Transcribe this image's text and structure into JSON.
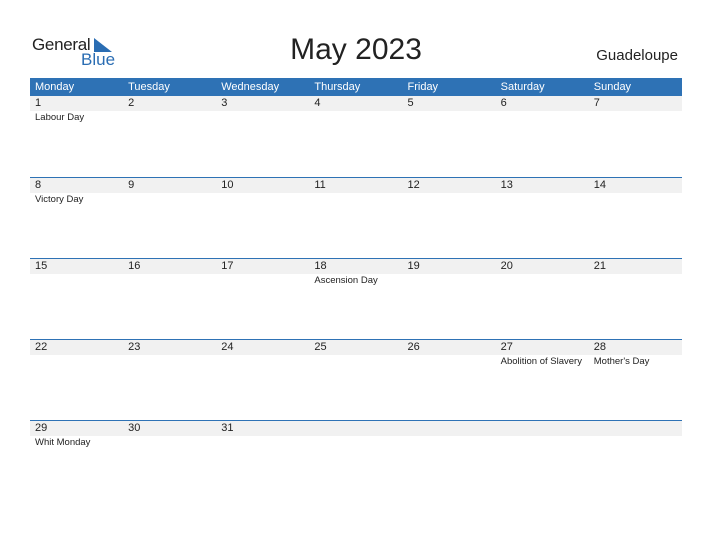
{
  "logo": {
    "word1": "General",
    "word2": "Blue"
  },
  "title": "May 2023",
  "country": "Guadeloupe",
  "colors": {
    "accent": "#2e72b5",
    "band": "#f1f1f1"
  },
  "weekdays": [
    "Monday",
    "Tuesday",
    "Wednesday",
    "Thursday",
    "Friday",
    "Saturday",
    "Sunday"
  ],
  "weeks": [
    [
      {
        "day": "1",
        "holiday": "Labour Day"
      },
      {
        "day": "2",
        "holiday": ""
      },
      {
        "day": "3",
        "holiday": ""
      },
      {
        "day": "4",
        "holiday": ""
      },
      {
        "day": "5",
        "holiday": ""
      },
      {
        "day": "6",
        "holiday": ""
      },
      {
        "day": "7",
        "holiday": ""
      }
    ],
    [
      {
        "day": "8",
        "holiday": "Victory Day"
      },
      {
        "day": "9",
        "holiday": ""
      },
      {
        "day": "10",
        "holiday": ""
      },
      {
        "day": "11",
        "holiday": ""
      },
      {
        "day": "12",
        "holiday": ""
      },
      {
        "day": "13",
        "holiday": ""
      },
      {
        "day": "14",
        "holiday": ""
      }
    ],
    [
      {
        "day": "15",
        "holiday": ""
      },
      {
        "day": "16",
        "holiday": ""
      },
      {
        "day": "17",
        "holiday": ""
      },
      {
        "day": "18",
        "holiday": "Ascension Day"
      },
      {
        "day": "19",
        "holiday": ""
      },
      {
        "day": "20",
        "holiday": ""
      },
      {
        "day": "21",
        "holiday": ""
      }
    ],
    [
      {
        "day": "22",
        "holiday": ""
      },
      {
        "day": "23",
        "holiday": ""
      },
      {
        "day": "24",
        "holiday": ""
      },
      {
        "day": "25",
        "holiday": ""
      },
      {
        "day": "26",
        "holiday": ""
      },
      {
        "day": "27",
        "holiday": "Abolition of Slavery"
      },
      {
        "day": "28",
        "holiday": "Mother's Day"
      }
    ],
    [
      {
        "day": "29",
        "holiday": "Whit Monday"
      },
      {
        "day": "30",
        "holiday": ""
      },
      {
        "day": "31",
        "holiday": ""
      },
      {
        "day": "",
        "holiday": ""
      },
      {
        "day": "",
        "holiday": ""
      },
      {
        "day": "",
        "holiday": ""
      },
      {
        "day": "",
        "holiday": ""
      }
    ]
  ]
}
